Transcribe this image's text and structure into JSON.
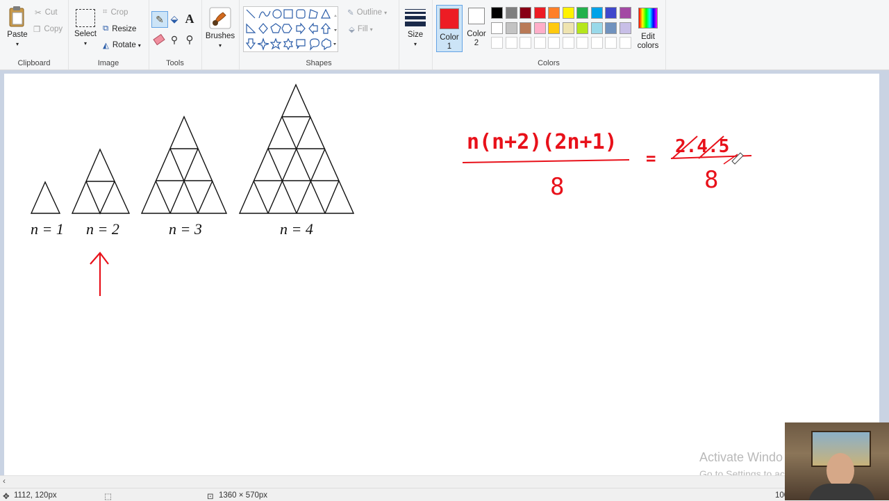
{
  "clipboard": {
    "paste": "Paste",
    "cut": "Cut",
    "copy": "Copy",
    "label": "Clipboard"
  },
  "image": {
    "select": "Select",
    "crop": "Crop",
    "resize": "Resize",
    "rotate": "Rotate",
    "label": "Image"
  },
  "tools": {
    "label": "Tools"
  },
  "brushes": {
    "label": "Brushes"
  },
  "shapes": {
    "outline": "Outline",
    "fill": "Fill",
    "label": "Shapes"
  },
  "size": {
    "label": "Size"
  },
  "colors": {
    "color1": "Color 1",
    "color1_line1": "Color",
    "color1_line2": "1",
    "color2_line1": "Color",
    "color2_line2": "2",
    "edit_line1": "Edit",
    "edit_line2": "colors",
    "label": "Colors",
    "color1_value": "#ed1c24",
    "color2_value": "#ffffff",
    "palette_row1": [
      "#000000",
      "#7f7f7f",
      "#880015",
      "#ed1c24",
      "#ff7f27",
      "#fff200",
      "#22b14c",
      "#00a2e8",
      "#3f48cc",
      "#a349a4"
    ],
    "palette_row2": [
      "#ffffff",
      "#c3c3c3",
      "#b97a57",
      "#ffaec9",
      "#ffc90e",
      "#efe4b0",
      "#b5e61d",
      "#99d9ea",
      "#7092be",
      "#c8bfe7"
    ],
    "palette_row3": [
      "#ffffff",
      "#ffffff",
      "#ffffff",
      "#ffffff",
      "#ffffff",
      "#ffffff",
      "#ffffff",
      "#ffffff",
      "#ffffff",
      "#ffffff"
    ]
  },
  "drawing": {
    "labels": [
      "n = 1",
      "n = 2",
      "n = 3",
      "n = 4"
    ],
    "ink_color": "#e8111a",
    "formula_numerator": "n(n+2)(2n+1)",
    "formula_denominator": "8",
    "result_numerator": "2.4.5",
    "result_denominator": "8",
    "equals": "="
  },
  "status": {
    "cursor": "1112, 120px",
    "canvas_size": "1360 × 570px",
    "zoom": "100"
  },
  "watermark": {
    "line1": "Activate Windo",
    "line2": "Go to Settings to ac"
  }
}
